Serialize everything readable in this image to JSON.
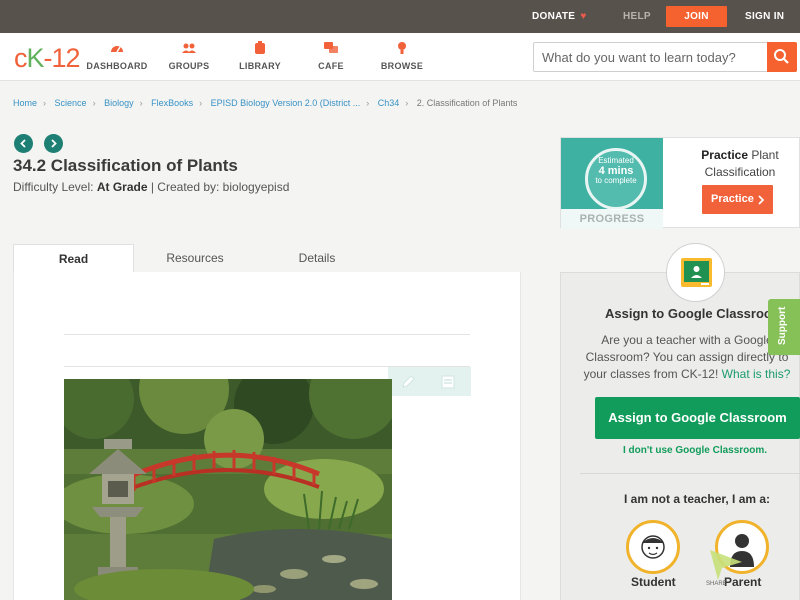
{
  "topbar": {
    "donate": "DONATE",
    "help": "HELP",
    "join": "JOIN",
    "signin": "SIGN IN"
  },
  "header": {
    "logo_c": "c",
    "logo_k": "K",
    "logo_rest": "-12",
    "nav": [
      {
        "label": "DASHBOARD",
        "icon": "dashboard-icon"
      },
      {
        "label": "GROUPS",
        "icon": "groups-icon"
      },
      {
        "label": "LIBRARY",
        "icon": "library-icon"
      },
      {
        "label": "CAFE",
        "icon": "cafe-icon"
      },
      {
        "label": "BROWSE",
        "icon": "browse-icon"
      }
    ],
    "search_placeholder": "What do you want to learn today?"
  },
  "breadcrumb": {
    "items": [
      "Home",
      "Science",
      "Biology",
      "FlexBooks",
      "EPISD Biology Version 2.0 (District ...",
      "Ch34"
    ],
    "current": "2. Classification of Plants"
  },
  "article": {
    "title": "34.2 Classification of Plants",
    "difficulty_label": "Difficulty Level:",
    "difficulty_value": "At Grade",
    "created_by": "| Created by: biologyepisd"
  },
  "tabs": [
    "Read",
    "Resources",
    "Details"
  ],
  "practice": {
    "estimated": "Estimated",
    "mins": "4 mins",
    "to_complete": "to complete",
    "progress": "PROGRESS",
    "title_bold": "Practice",
    "title_rest": " Plant Classification",
    "button": "Practice"
  },
  "google_classroom": {
    "title": "Assign to Google Classroom",
    "desc": "Are you a teacher with a Google Classroom? You can assign directly to your classes from CK-12!",
    "what_link": "What is this?",
    "button": "Assign to Google Classroom",
    "no_use": "I don't use Google Classroom.",
    "not_teacher": "I am not a teacher, I am a:",
    "student": "Student",
    "parent": "Parent"
  },
  "support": "Support",
  "share": "SHARE",
  "colors": {
    "accent": "#f5622f",
    "green": "#119c5b",
    "teal": "#1e7f74",
    "topbar": "#58524c"
  }
}
